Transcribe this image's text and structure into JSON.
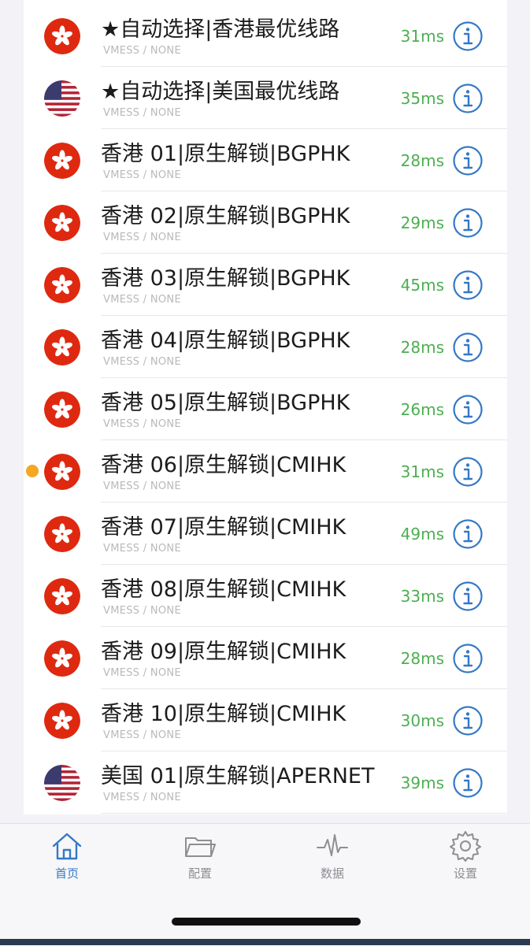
{
  "servers": [
    {
      "flag": "hk",
      "name": "★自动选择|香港最优线路",
      "protocol": "VMESS / NONE",
      "latency": "31ms",
      "selected": false
    },
    {
      "flag": "us",
      "name": "★自动选择|美国最优线路",
      "protocol": "VMESS / NONE",
      "latency": "35ms",
      "selected": false
    },
    {
      "flag": "hk",
      "name": "香港 01|原生解锁|BGPHK",
      "protocol": "VMESS / NONE",
      "latency": "28ms",
      "selected": false
    },
    {
      "flag": "hk",
      "name": "香港 02|原生解锁|BGPHK",
      "protocol": "VMESS / NONE",
      "latency": "29ms",
      "selected": false
    },
    {
      "flag": "hk",
      "name": "香港 03|原生解锁|BGPHK",
      "protocol": "VMESS / NONE",
      "latency": "45ms",
      "selected": false
    },
    {
      "flag": "hk",
      "name": "香港 04|原生解锁|BGPHK",
      "protocol": "VMESS / NONE",
      "latency": "28ms",
      "selected": false
    },
    {
      "flag": "hk",
      "name": "香港 05|原生解锁|BGPHK",
      "protocol": "VMESS / NONE",
      "latency": "26ms",
      "selected": false
    },
    {
      "flag": "hk",
      "name": "香港 06|原生解锁|CMIHK",
      "protocol": "VMESS / NONE",
      "latency": "31ms",
      "selected": true
    },
    {
      "flag": "hk",
      "name": "香港 07|原生解锁|CMIHK",
      "protocol": "VMESS / NONE",
      "latency": "49ms",
      "selected": false
    },
    {
      "flag": "hk",
      "name": "香港 08|原生解锁|CMIHK",
      "protocol": "VMESS / NONE",
      "latency": "33ms",
      "selected": false
    },
    {
      "flag": "hk",
      "name": "香港 09|原生解锁|CMIHK",
      "protocol": "VMESS / NONE",
      "latency": "28ms",
      "selected": false
    },
    {
      "flag": "hk",
      "name": "香港 10|原生解锁|CMIHK",
      "protocol": "VMESS / NONE",
      "latency": "30ms",
      "selected": false
    },
    {
      "flag": "us",
      "name": "美国 01|原生解锁|APERNET",
      "protocol": "VMESS / NONE",
      "latency": "39ms",
      "selected": false
    }
  ],
  "tabbar": {
    "tabs": [
      {
        "id": "home",
        "label": "首页",
        "icon": "home-icon",
        "active": true
      },
      {
        "id": "config",
        "label": "配置",
        "icon": "folder-icon",
        "active": false
      },
      {
        "id": "data",
        "label": "数据",
        "icon": "waveform-icon",
        "active": false
      },
      {
        "id": "settings",
        "label": "设置",
        "icon": "gear-icon",
        "active": false
      }
    ]
  },
  "colors": {
    "latency": "#4caf50",
    "info_icon": "#3478c6",
    "selected_dot": "#f5a623",
    "hk_flag": "#de2910",
    "active_tab": "#3478c6",
    "inactive_tab": "#8e8e93"
  }
}
